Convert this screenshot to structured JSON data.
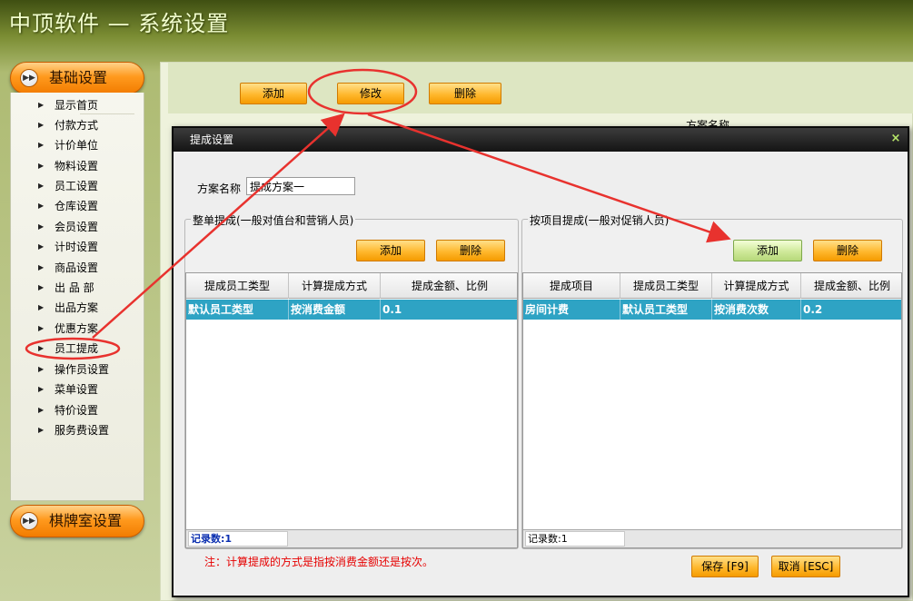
{
  "app": {
    "title": "中顶软件 — 系统设置"
  },
  "sidebar": {
    "basic_section_label": "基础设置",
    "chess_section_label": "棋牌室设置",
    "items": [
      {
        "label": "显示首页"
      },
      {
        "label": "付款方式"
      },
      {
        "label": "计价单位"
      },
      {
        "label": "物料设置"
      },
      {
        "label": "员工设置"
      },
      {
        "label": "仓库设置"
      },
      {
        "label": "会员设置"
      },
      {
        "label": "计时设置"
      },
      {
        "label": "商品设置"
      },
      {
        "label": "出 品 部"
      },
      {
        "label": "出品方案"
      },
      {
        "label": "优惠方案"
      },
      {
        "label": "员工提成"
      },
      {
        "label": "操作员设置"
      },
      {
        "label": "菜单设置"
      },
      {
        "label": "特价设置"
      },
      {
        "label": "服务费设置"
      }
    ]
  },
  "main": {
    "toolbar": {
      "add_label": "添加",
      "edit_label": "修改",
      "delete_label": "删除"
    },
    "header_text": "方案名称"
  },
  "dialog": {
    "title": "提成设置",
    "close_glyph": "×",
    "scheme_label": "方案名称",
    "scheme_value": "提成方案一",
    "whole_order": {
      "group_title": "整单提成(一般对值台和营销人员)",
      "add_label": "添加",
      "delete_label": "删除",
      "columns": [
        "提成员工类型",
        "计算提成方式",
        "提成金额、比例"
      ],
      "rows": [
        [
          "默认员工类型",
          "按消费金额",
          "0.1"
        ]
      ],
      "record_count": "记录数:1"
    },
    "by_item": {
      "group_title": "按项目提成(一般对促销人员)",
      "add_label": "添加",
      "delete_label": "删除",
      "columns": [
        "提成项目",
        "提成员工类型",
        "计算提成方式",
        "提成金额、比例"
      ],
      "rows": [
        [
          "房间计费",
          "默认员工类型",
          "按消费次数",
          "0.2"
        ]
      ],
      "record_count": "记录数:1"
    },
    "note": "注：计算提成的方式是指按消费金额还是按次。",
    "save_label": "保存 [F9]",
    "cancel_label": "取消 [ESC]"
  },
  "colors": {
    "accent_orange": "#ff9a1e",
    "selected_row": "#2ea3c4",
    "annotation_red": "#e8322e",
    "note_red": "#e60000"
  }
}
